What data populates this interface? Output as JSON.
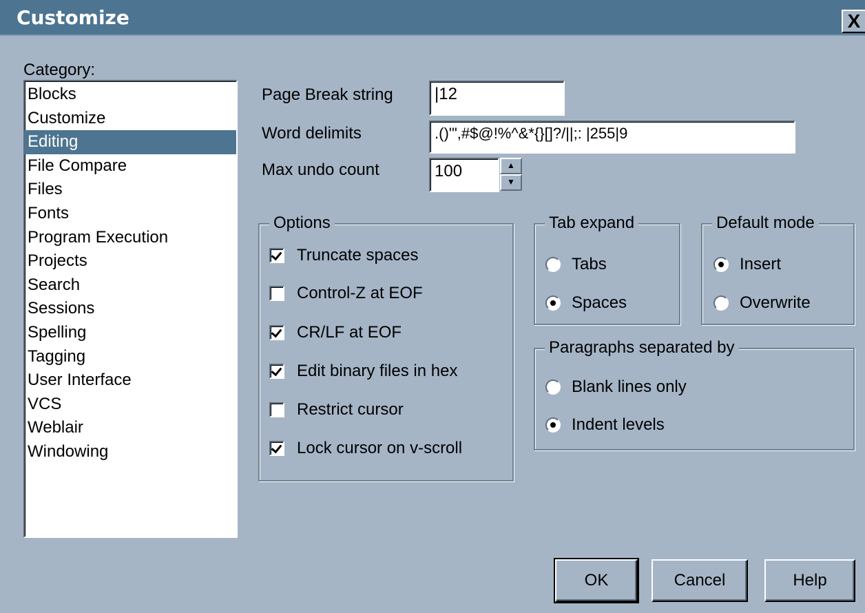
{
  "window": {
    "title": "Customize",
    "close_glyph": "X"
  },
  "category": {
    "label": "Category:",
    "items": [
      "Blocks",
      "Customize",
      "Editing",
      "File Compare",
      "Files",
      "Fonts",
      "Program Execution",
      "Projects",
      "Search",
      "Sessions",
      "Spelling",
      "Tagging",
      "User Interface",
      "VCS",
      "Weblair",
      "Windowing"
    ],
    "selected": "Editing"
  },
  "fields": {
    "page_break_label": "Page Break string",
    "page_break_value": "|12",
    "word_delimits_label": "Word delimits",
    "word_delimits_value": ".()'\",#$@!%^&*{}[]?/||;: |255|9",
    "max_undo_label": "Max undo count",
    "max_undo_value": "100"
  },
  "options": {
    "title": "Options",
    "items": [
      {
        "label": "Truncate spaces",
        "checked": true
      },
      {
        "label": "Control-Z at EOF",
        "checked": false
      },
      {
        "label": "CR/LF at EOF",
        "checked": true
      },
      {
        "label": "Edit binary files in hex",
        "checked": true
      },
      {
        "label": "Restrict cursor",
        "checked": false
      },
      {
        "label": "Lock cursor on v-scroll",
        "checked": true
      }
    ]
  },
  "tab_expand": {
    "title": "Tab expand",
    "options": [
      {
        "label": "Tabs",
        "selected": false
      },
      {
        "label": "Spaces",
        "selected": true
      }
    ]
  },
  "default_mode": {
    "title": "Default mode",
    "options": [
      {
        "label": "Insert",
        "selected": true
      },
      {
        "label": "Overwrite",
        "selected": false
      }
    ]
  },
  "paragraphs": {
    "title": "Paragraphs separated by",
    "options": [
      {
        "label": "Blank lines only",
        "selected": false
      },
      {
        "label": "Indent levels",
        "selected": true
      }
    ]
  },
  "buttons": {
    "ok": "OK",
    "cancel": "Cancel",
    "help": "Help"
  },
  "colors": {
    "dialog_bg": "#a5b5c6",
    "titlebar": "#4d7591",
    "selection": "#4d7591"
  }
}
